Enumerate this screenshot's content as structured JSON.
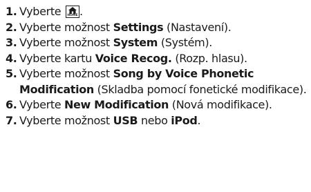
{
  "steps": [
    {
      "num": "1.",
      "t1": "Vyberte ",
      "icon_name": "home-icon",
      "icon_label": "HOME",
      "t2": "."
    },
    {
      "num": "2.",
      "t1": "Vyberte možnost ",
      "b1": "Settings",
      "t2": " (Nastavení)."
    },
    {
      "num": "3.",
      "t1": "Vyberte možnost ",
      "b1": "System",
      "t2": " (Systém)."
    },
    {
      "num": "4.",
      "t1": "Vyberte kartu ",
      "b1": "Voice Recog.",
      "t2": " (Rozp. hlasu)."
    },
    {
      "num": "5.",
      "t1": "Vyberte možnost ",
      "b1": "Song by Voice Phonetic Modification",
      "t2": " (Skladba pomocí fonetické modifikace)."
    },
    {
      "num": "6.",
      "t1": "Vyberte ",
      "b1": "New Modification",
      "t2": " (Nová modifikace)."
    },
    {
      "num": "7.",
      "t1": "Vyberte možnost ",
      "b1": "USB",
      "t2": " nebo ",
      "b2": "iPod",
      "t3": "."
    }
  ]
}
